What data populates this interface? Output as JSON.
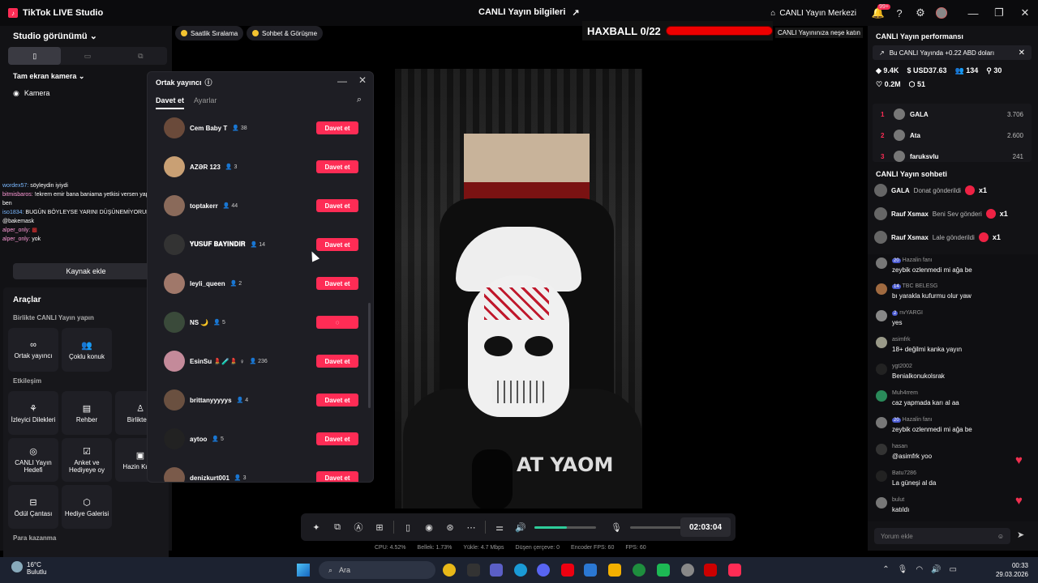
{
  "window": {
    "app_title": "TikTok LIVE Studio",
    "center_title": "CANLI Yayın bilgileri",
    "live_center_label": "CANLI Yayın Merkezi",
    "notification_count": "99+"
  },
  "left_panel": {
    "studio_view_label": "Studio görünümü",
    "fullscreen_camera_label": "Tam ekran kamera",
    "camera_label": "Kamera",
    "chat_overlay": [
      {
        "user": "wordex57:",
        "text": "söyleydin iyiydi"
      },
      {
        "user": "bitmisbaros:",
        "text": "!ekrem emir bana baniama yetkisi versen yaparsım ben"
      },
      {
        "user": "iso1834:",
        "text": "BUGÜN BÖYLEYSE YARINI DÜŞÜNEMİYORUM AMK @bakemask"
      },
      {
        "user": "alper_only:",
        "text": ""
      },
      {
        "user": "alper_only:",
        "text": "yok"
      }
    ],
    "add_source_label": "Kaynak ekle",
    "tools_title": "Araçlar",
    "go_live_together_label": "Birlikte CANLI Yayın yapın",
    "cohost_label": "Ortak yayıncı",
    "multi_guest_label": "Çoklu konuk",
    "interaction_label": "Etkileşim",
    "viewer_requests_label": "İzleyici Dilekleri",
    "guide_label": "Rehber",
    "together_label": "Birlikte O",
    "live_goal_label": "CANLI Yayın Hedefi",
    "poll_label": "Anket ve Hediyeye oy",
    "treasure_label": "Hazin Kutus",
    "reward_bag_label": "Ödül Çantası",
    "gift_gallery_label": "Hediye Galerisi",
    "earn_money_label": "Para kazanma"
  },
  "top_chips": {
    "hourly_ranking": "Saatlik Sıralama",
    "chat_meet": "Sohbet & Görüşme"
  },
  "overlay": {
    "haxball_label": "HAXBALL 0/22",
    "haxball_progress": 0,
    "banner_text": "CANLI Yayınınıza neşe katın"
  },
  "dialog": {
    "title": "Ortak yayıncı",
    "tab_invite": "Davet et",
    "tab_settings": "Ayarlar",
    "invite_label": "Davet et",
    "users": [
      {
        "name": "Cem Baby T",
        "count": "38"
      },
      {
        "name": "AZƏR 123",
        "count": "3"
      },
      {
        "name": "toptakerr",
        "count": "44"
      },
      {
        "name": "𝐘𝐔𝐒𝐔𝐅 𝐁𝐀𝐘𝐈𝐍𝐃𝐈𝐑",
        "count": "14"
      },
      {
        "name": "leyli_queen",
        "count": "2"
      },
      {
        "name": "NS 🌙",
        "count": "5"
      },
      {
        "name": "EsinSu 💄🧪💄 ♀",
        "count": "236"
      },
      {
        "name": "brittanyyyyys",
        "count": "4"
      },
      {
        "name": "aytoo",
        "count": "5"
      },
      {
        "name": "denizkurt001",
        "count": "3"
      }
    ]
  },
  "video": {
    "shirt_text": "AT YAOM"
  },
  "control_bar": {
    "timer": "02:03:04",
    "volume": 0.52
  },
  "stats": {
    "cpu": "CPU: 4.52%",
    "memory": "Bellek: 1.73%",
    "upload": "Yükle: 4.7 Mbps",
    "dropped": "Düşen çerçeve: 0",
    "encoder_fps": "Encoder FPS: 60",
    "fps": "FPS: 60"
  },
  "right_panel": {
    "performance_title": "CANLI Yayın performansı",
    "earn_text": "Bu CANLI Yayında +0.22 ABD doları",
    "metrics": {
      "diamonds": "9.4K",
      "usd": "USD37.63",
      "viewers": "134",
      "new_followers": "30",
      "likes": "0.2M",
      "gifters": "51"
    },
    "ranking": [
      {
        "rank": "1",
        "name": "GALA",
        "value": "3.706"
      },
      {
        "rank": "2",
        "name": "Ata",
        "value": "2.600"
      },
      {
        "rank": "3",
        "name": "faruksvlu",
        "value": "241"
      }
    ],
    "chat_title": "CANLI Yayın sohbeti",
    "gift_events": [
      {
        "name": "GALA",
        "text": "Donat gönderildi",
        "count": "x1"
      },
      {
        "name": "Rauf Xsmax",
        "text": "Beni Sev gönderi",
        "count": "x1"
      },
      {
        "name": "Rauf Xsmax",
        "text": "Lale gönderildi",
        "count": "x1"
      }
    ],
    "messages": [
      {
        "user": "Hazalin fanı",
        "level": "20",
        "text": "zeybik ozlenmedi mi ağa be"
      },
      {
        "user": "TBC BELESG",
        "level": "14",
        "text": "bı yarakla kufurmu olur yaw"
      },
      {
        "user": "nvYARGI",
        "level": "2",
        "text": "yes"
      },
      {
        "user": "asimfrk",
        "level": "",
        "text": "18+ değilmi kanka yayın"
      },
      {
        "user": "ygt2002",
        "level": "",
        "text": "Benialkonukolsrak"
      },
      {
        "user": "Muh4rrem",
        "level": "",
        "text": "caz yapmada karı al aa"
      },
      {
        "user": "Hazalin fanı",
        "level": "20",
        "text": "zeybik ozlenmedi mi ağa be"
      },
      {
        "user": "hasan",
        "level": "",
        "text": "@asimfrk yoo"
      },
      {
        "user": "Batu7286",
        "level": "",
        "text": "La güneşi al da"
      },
      {
        "user": "bulut",
        "level": "",
        "text": "katıldı"
      }
    ],
    "comment_placeholder": "Yorum ekle"
  },
  "taskbar": {
    "temperature": "16°C",
    "weather": "Bulutlu",
    "search_placeholder": "Ara",
    "time": "00:33",
    "date": "29.03.2026"
  },
  "colors": {
    "accent": "#fe2c55",
    "volume": "#2ecc9a"
  }
}
